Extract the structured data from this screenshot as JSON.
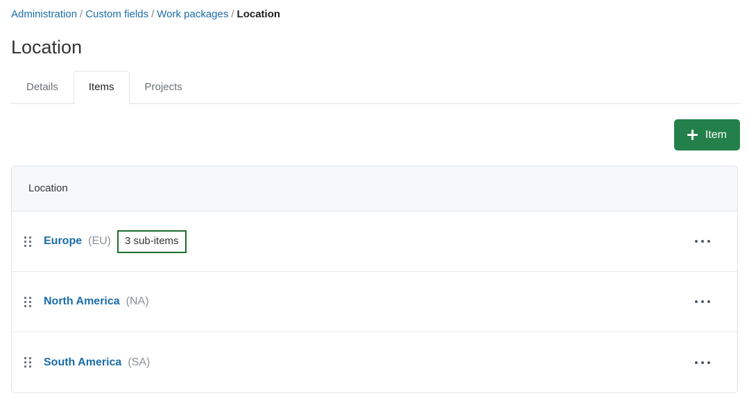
{
  "breadcrumb": {
    "separator": "/",
    "items": [
      {
        "label": "Administration",
        "current": false
      },
      {
        "label": "Custom fields",
        "current": false
      },
      {
        "label": "Work packages",
        "current": false
      },
      {
        "label": "Location",
        "current": true
      }
    ]
  },
  "page": {
    "title": "Location"
  },
  "tabs": [
    {
      "label": "Details",
      "active": false
    },
    {
      "label": "Items",
      "active": true
    },
    {
      "label": "Projects",
      "active": false
    }
  ],
  "toolbar": {
    "add_item_label": "Item",
    "add_item_icon": "plus-icon",
    "add_item_color": "#23804a"
  },
  "table": {
    "header": "Location",
    "rows": [
      {
        "drag_icon": "drag-handle-icon",
        "name": "Europe",
        "short": "(EU)",
        "badge": "3 sub-items",
        "badge_border_color": "#1c6b2d",
        "menu_icon": "kebab-menu-icon"
      },
      {
        "drag_icon": "drag-handle-icon",
        "name": "North America",
        "short": "(NA)",
        "badge": null,
        "menu_icon": "kebab-menu-icon"
      },
      {
        "drag_icon": "drag-handle-icon",
        "name": "South America",
        "short": "(SA)",
        "badge": null,
        "menu_icon": "kebab-menu-icon"
      }
    ]
  },
  "colors": {
    "link": "#1a6ca8",
    "accent_green": "#23804a",
    "border": "#dfe3e6",
    "header_bg": "#f7f8fa",
    "muted_text": "#8b9095"
  }
}
